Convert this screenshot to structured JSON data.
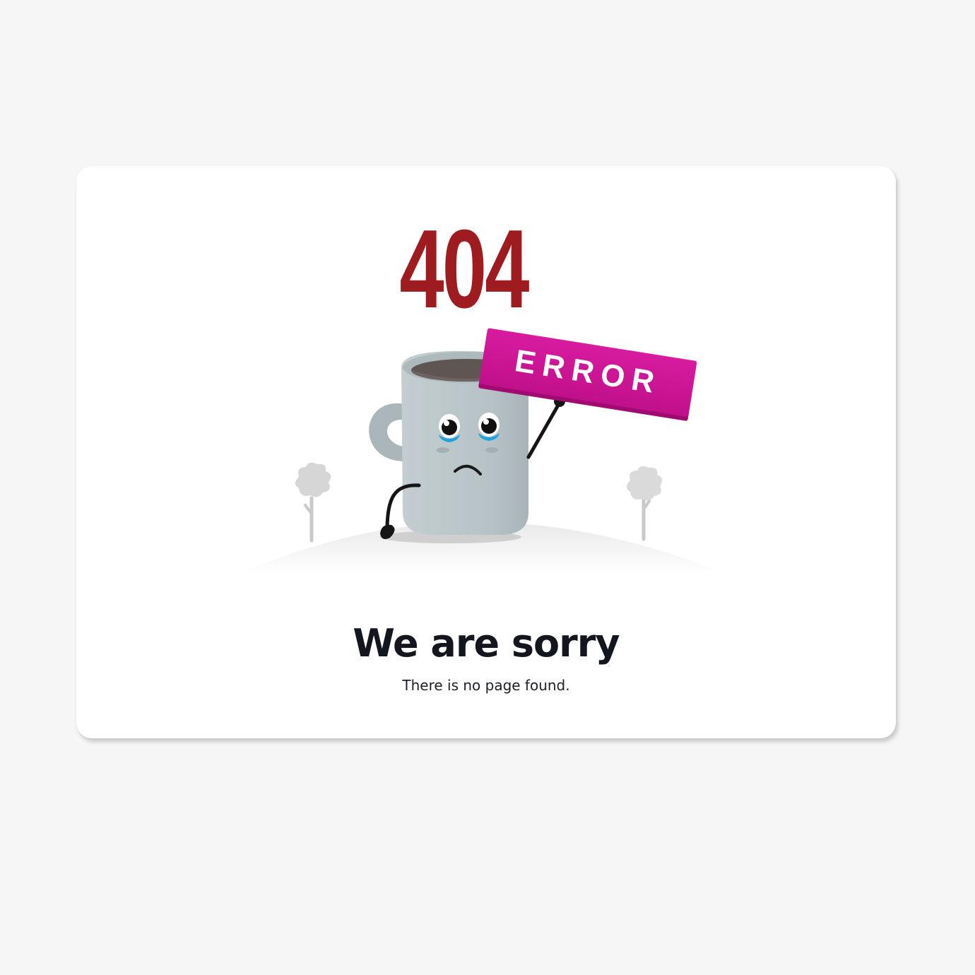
{
  "error_code": "404",
  "sign_text": "ERROR",
  "heading": "We are sorry",
  "message": "There is no page found.",
  "colors": {
    "page_background": "#f6f6f6",
    "card_background": "#ffffff",
    "code_color": "#9e1b20",
    "sign_color": "#d6159a",
    "mug_color": "#b9c5c8",
    "heading_color": "#14161f"
  },
  "icons": [
    "mug-character-icon",
    "error-sign-icon",
    "tree-icon"
  ]
}
